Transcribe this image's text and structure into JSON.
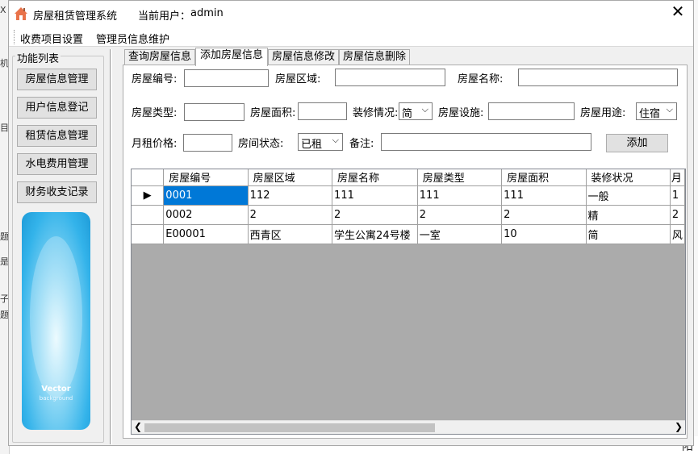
{
  "window": {
    "title": "房屋租赁管理系统",
    "user_label": "当前用户：",
    "user_name": "admin",
    "close_glyph": "✕"
  },
  "menu": {
    "items": [
      "收费项目设置",
      "管理员信息维护"
    ]
  },
  "sidebar": {
    "title": "功能列表",
    "buttons": [
      "房屋信息管理",
      "用户信息登记",
      "租赁信息管理",
      "水电费用管理",
      "财务收支记录"
    ],
    "image_text": "Vector",
    "image_subtext": "background"
  },
  "tabs": [
    "查询房屋信息",
    "添加房屋信息",
    "房屋信息修改",
    "房屋信息删除"
  ],
  "active_tab": 1,
  "form": {
    "house_no_label": "房屋编号:",
    "house_no_value": "",
    "area_label": "房屋区域:",
    "area_value": "",
    "name_label": "房屋名称:",
    "name_value": "",
    "type_label": "房屋类型:",
    "type_value": "",
    "size_label": "房屋面积:",
    "size_value": "",
    "decor_label": "装修情况:",
    "decor_value": "简",
    "facility_label": "房屋设施:",
    "facility_value": "",
    "use_label": "房屋用途:",
    "use_value": "住宿",
    "rent_label": "月租价格:",
    "rent_value": "",
    "status_label": "房间状态:",
    "status_value": "已租",
    "note_label": "备注:",
    "note_value": "",
    "add_button": "添加"
  },
  "grid": {
    "columns": [
      "房屋编号",
      "房屋区域",
      "房屋名称",
      "房屋类型",
      "房屋面积",
      "装修状况",
      "月"
    ],
    "rows": [
      [
        "0001",
        "112",
        "111",
        "111",
        "111",
        "一般",
        "1"
      ],
      [
        "0002",
        "2",
        "2",
        "2",
        "2",
        "精",
        "2"
      ],
      [
        "E00001",
        "西青区",
        "学生公寓24号楼",
        "一室",
        "10",
        "简",
        "风"
      ]
    ],
    "current_row_marker": "▶"
  },
  "background": {
    "left_fragments": [
      "X",
      "机",
      "目",
      "题",
      "是",
      "子",
      "题"
    ],
    "bottom_fragment": "阳"
  }
}
